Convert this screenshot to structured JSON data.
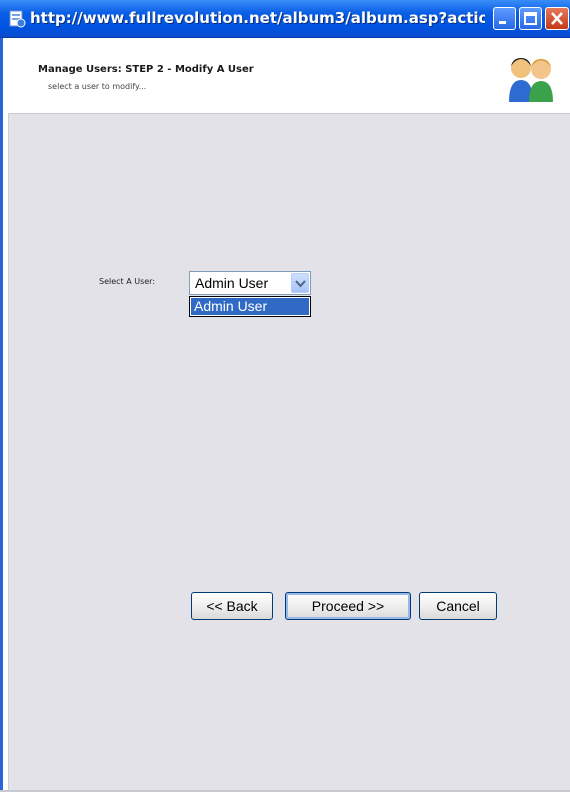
{
  "window": {
    "title": "http://www.fullrevolution.net/album3/album.asp?actio...",
    "icon": "page-icon",
    "controls": {
      "minimize_icon": "minimize-icon",
      "maximize_icon": "maximize-icon",
      "close_icon": "close-icon"
    }
  },
  "header": {
    "title": "Manage Users: STEP 2 - Modify A User",
    "subtitle": "select a user to modify...",
    "image": "users-icon"
  },
  "form": {
    "select_label": "Select A User:",
    "selected_value": "Admin User",
    "options": [
      "Admin User"
    ]
  },
  "buttons": {
    "back": "<< Back",
    "proceed": "Proceed >>",
    "cancel": "Cancel"
  },
  "colors": {
    "titlebar": "#0054e3",
    "content_bg": "#e3e2e8",
    "selection": "#316ac5"
  }
}
